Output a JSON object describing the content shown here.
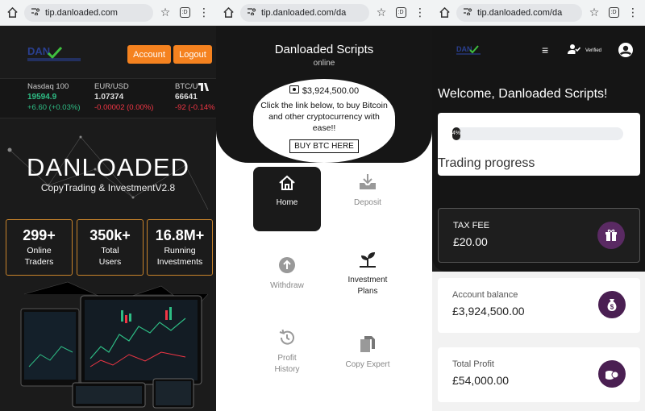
{
  "browser": {
    "url_full": "tip.danloaded.com",
    "url_truncated": "tip.danloaded.com/da",
    "tab_count": ":D"
  },
  "landing": {
    "logo_text": "DAN",
    "account_label": "Account",
    "logout_label": "Logout",
    "tickers": [
      {
        "symbol": "Nasdaq 100",
        "price": "19594.9",
        "change": "+6.60 (+0.03%)",
        "direction": "up"
      },
      {
        "symbol": "EUR/USD",
        "price": "1.07374",
        "change": "-0.00002 (0.00%)",
        "direction": "down"
      },
      {
        "symbol": "BTC/U",
        "price": "66641",
        "change": "-92 (-0.14%",
        "direction": "down"
      }
    ],
    "ticker_fragment": ")",
    "hero_title": "DANLOADED",
    "hero_subtitle": "CopyTrading & InvestmentV2.8",
    "stats": [
      {
        "value": "299+",
        "label_line1": "Online",
        "label_line2": "Traders"
      },
      {
        "value": "350k+",
        "label_line1": "Total",
        "label_line2": "Users"
      },
      {
        "value": "16.8M+",
        "label_line1": "Running",
        "label_line2": "Investments"
      }
    ]
  },
  "menu": {
    "title": "Danloaded Scripts",
    "status": "online",
    "promo_amount": "$3,924,500.00",
    "promo_message": "Click the link below, to buy Bitcoin and other cryptocurrency with ease!!",
    "buy_label": "BUY BTC HERE",
    "tiles": {
      "home": "Home",
      "deposit": "Deposit",
      "withdraw": "Withdraw",
      "invest_line1": "Investment",
      "invest_line2": "Plans",
      "history_line1": "Profit",
      "history_line2": "History",
      "copy": "Copy Expert"
    }
  },
  "dashboard": {
    "verified_label": "Verified",
    "welcome": "Welcome, Danloaded Scripts!",
    "progress_value": "4%",
    "progress_fraction": 0.04,
    "progress_label": "Trading progress",
    "tax_label": "TAX FEE",
    "tax_value": "£20.00",
    "balance_label": "Account balance",
    "balance_value": "£3,924,500.00",
    "profit_label": "Total Profit",
    "profit_value": "£54,000.00"
  },
  "colors": {
    "accent_orange": "#f5821f",
    "ticker_up": "#2ebd85",
    "ticker_down": "#f23645",
    "icon_purple": "#4a1f52"
  }
}
